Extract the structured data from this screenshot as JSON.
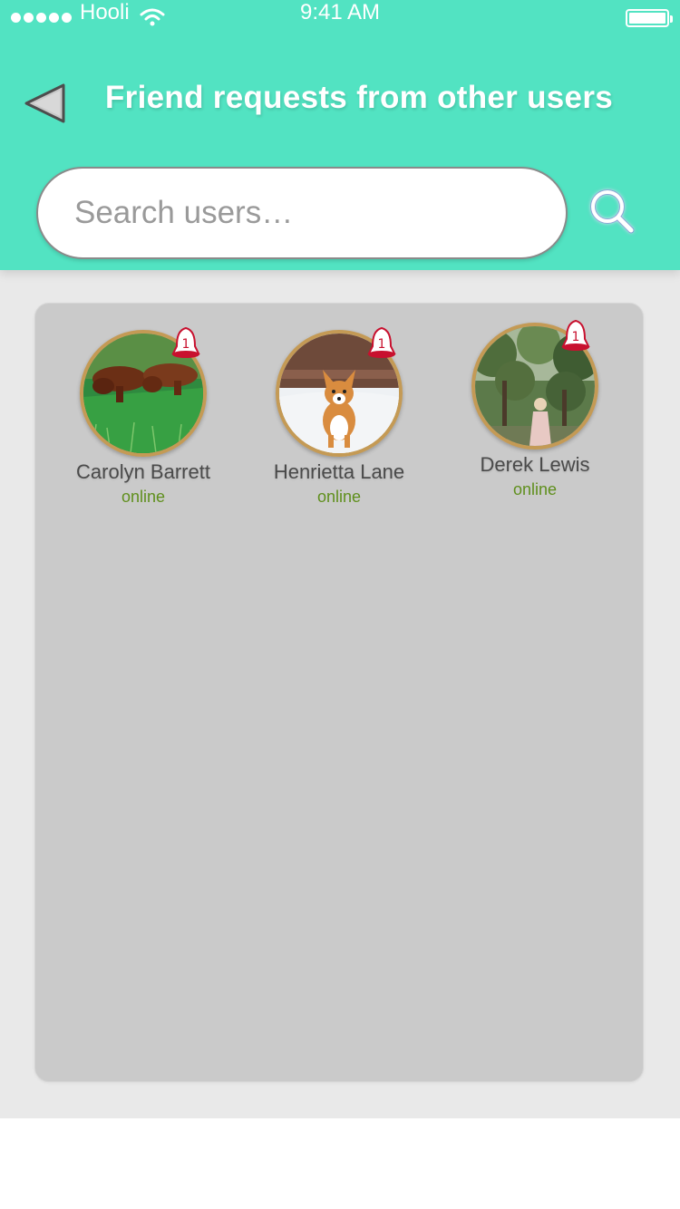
{
  "status_bar": {
    "carrier": "Hooli",
    "time": "9:41 AM",
    "signal_icon": "signal-dots-icon",
    "wifi_icon": "wifi-icon",
    "battery_icon": "battery-icon"
  },
  "header": {
    "back_icon": "back-arrow-icon",
    "title": "Friend requests from other users",
    "background_color": "#52e3c2"
  },
  "search": {
    "placeholder": "Search users…",
    "value": "",
    "icon": "search-icon"
  },
  "users": [
    {
      "name": "Carolyn Barrett",
      "status": "online",
      "badge": "1",
      "avatar": "dachshund-dogs-on-grass-photo",
      "badge_icon": "bell-icon"
    },
    {
      "name": "Henrietta Lane",
      "status": "online",
      "badge": "1",
      "avatar": "corgi-running-in-snow-photo",
      "badge_icon": "bell-icon"
    },
    {
      "name": "Derek Lewis",
      "status": "online",
      "badge": "1",
      "avatar": "girl-in-forest-photo",
      "badge_icon": "bell-icon"
    }
  ],
  "colors": {
    "accent": "#52e3c2",
    "online": "#5f8f1c",
    "badge": "#c8102e",
    "card": "#cacaca",
    "avatar_ring": "#c49a55"
  }
}
